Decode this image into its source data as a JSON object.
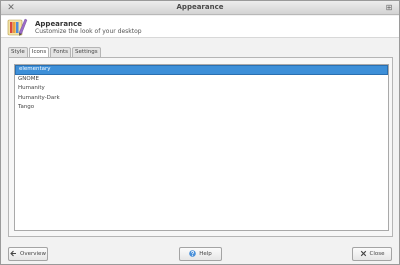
{
  "window": {
    "title": "Appearance",
    "close_glyph": "✕",
    "maximize_glyph": "⊞"
  },
  "header": {
    "title": "Appearance",
    "subtitle": "Customize the look of your desktop",
    "icon": "appearance-icon"
  },
  "tabs": [
    {
      "label": "Style",
      "active": false
    },
    {
      "label": "Icons",
      "active": true
    },
    {
      "label": "Fonts",
      "active": false
    },
    {
      "label": "Settings",
      "active": false
    }
  ],
  "icon_themes": [
    {
      "label": "elementary",
      "selected": true
    },
    {
      "label": "GNOME",
      "selected": false
    },
    {
      "label": "Humanity",
      "selected": false
    },
    {
      "label": "Humanity-Dark",
      "selected": false
    },
    {
      "label": "Tango",
      "selected": false
    }
  ],
  "buttons": {
    "overview_label": "Overview",
    "help_label": "Help",
    "close_label": "Close"
  },
  "colors": {
    "selection": "#3d8fd8",
    "help_icon": "#4a90d9"
  }
}
